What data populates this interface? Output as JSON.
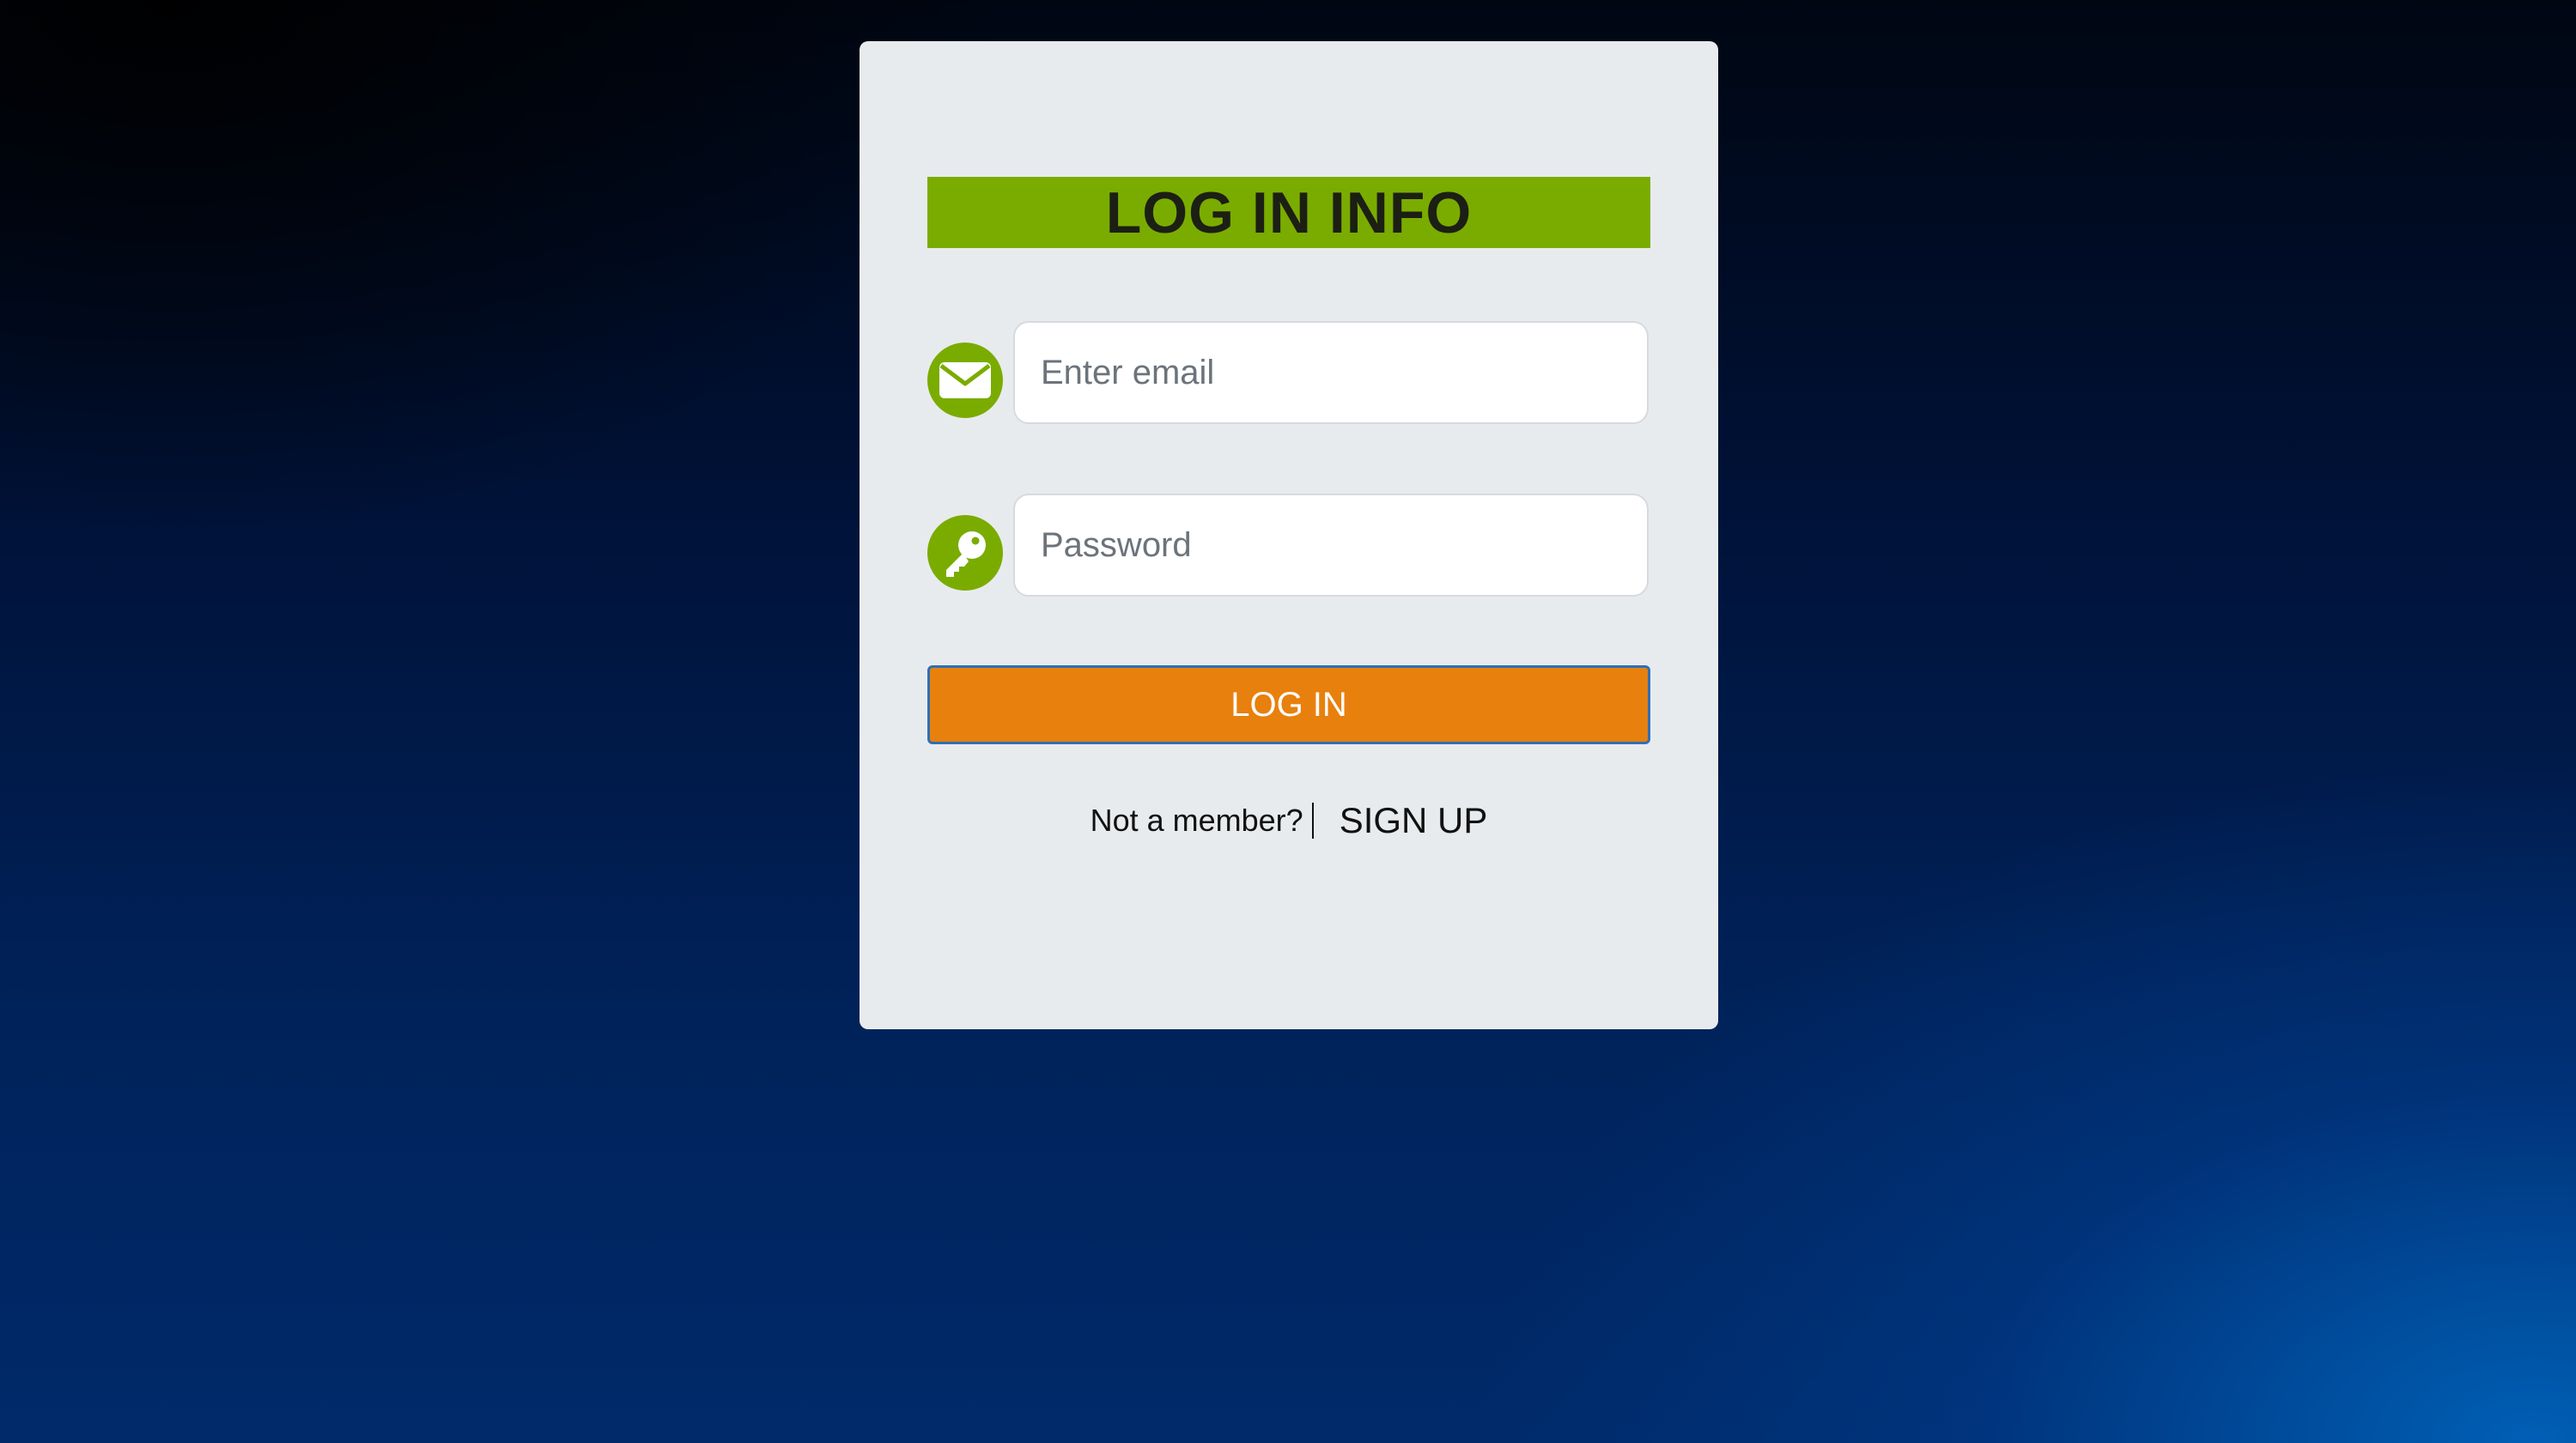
{
  "form": {
    "title": "LOG IN INFO",
    "email": {
      "icon": "envelope-icon",
      "placeholder": "Enter email",
      "value": ""
    },
    "password": {
      "icon": "key-icon",
      "placeholder": "Password",
      "value": ""
    },
    "login_label": "LOG IN",
    "not_member_text": "Not a member?",
    "signup_label": "SIGN UP"
  },
  "colors": {
    "accent_green": "#7aac00",
    "button_orange": "#e8800d",
    "card_background": "#e8ebee",
    "button_border_blue": "#2f6fb5"
  }
}
